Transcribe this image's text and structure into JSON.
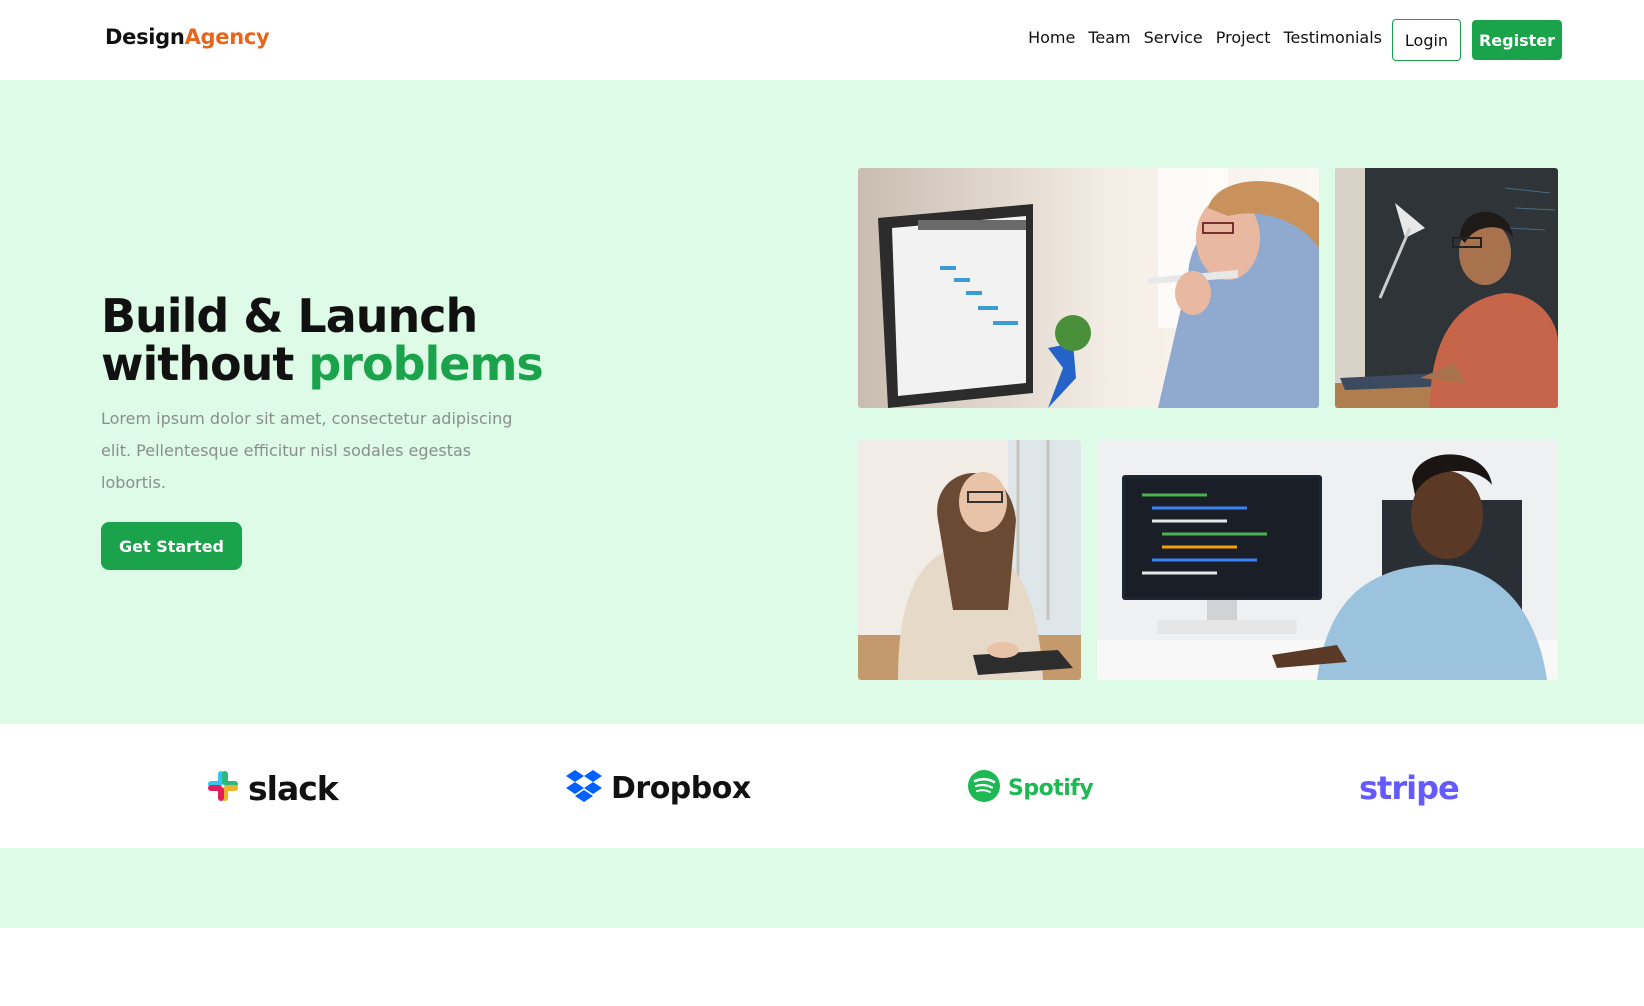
{
  "brand": {
    "part1": "Design",
    "part2": "Agency"
  },
  "nav": {
    "items": [
      {
        "label": "Home"
      },
      {
        "label": "Team"
      },
      {
        "label": "Service"
      },
      {
        "label": "Project"
      },
      {
        "label": "Testimonials"
      }
    ],
    "login_label": "Login",
    "register_label": "Register"
  },
  "hero": {
    "title_line1": "Build & Launch",
    "title_line2_plain": "without",
    "title_line2_accent": "problems",
    "description": "Lorem ipsum dolor sit amet, consectetur adipiscing elit. Pellentesque efficitur nisl sodales egestas lobortis.",
    "cta_label": "Get Started",
    "photos": [
      {
        "name": "photo-woman-gantt-chart"
      },
      {
        "name": "photo-man-laptop-chalkboard"
      },
      {
        "name": "photo-woman-laptop-glasses"
      },
      {
        "name": "photo-man-code-monitor"
      }
    ]
  },
  "partners": [
    {
      "label": "slack",
      "icon": "slack-icon"
    },
    {
      "label": "Dropbox",
      "icon": "dropbox-icon"
    },
    {
      "label": "Spotify",
      "icon": "spotify-icon"
    },
    {
      "label": "stripe",
      "icon": ""
    }
  ],
  "colors": {
    "accent": "#1aa34a",
    "brand_orange": "#e8661c",
    "hero_bg": "#ddfbe7",
    "muted_text": "#8a8f8c",
    "spotify": "#1db954",
    "stripe": "#635bff",
    "dropbox": "#0061ff"
  }
}
